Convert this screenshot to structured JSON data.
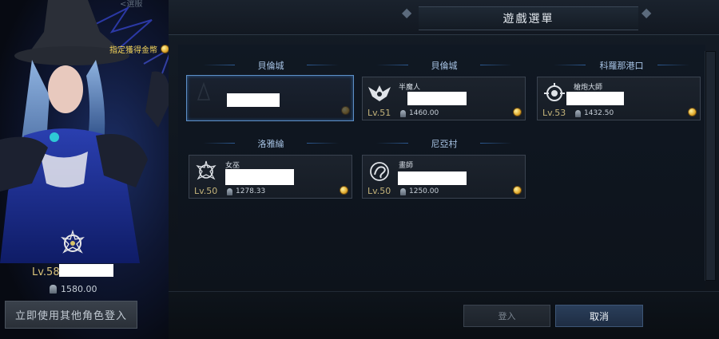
{
  "left_panel": {
    "top_label": "<選服",
    "gold_label": "指定獲得金幣",
    "main_character": {
      "level": "Lv.58",
      "item_level": "1580.00"
    },
    "other_character_button": "立即使用其他角色登入"
  },
  "menu": {
    "title": "遊戲選單",
    "servers": [
      {
        "name": "貝倫城",
        "characters": [
          {
            "class_name": "",
            "level": "",
            "item_level": "",
            "selected": true,
            "icon": "blank-class-icon"
          }
        ]
      },
      {
        "name": "貝倫城",
        "characters": [
          {
            "class_name": "半魔人",
            "level": "Lv.51",
            "item_level": "1460.00",
            "icon": "demon-class-icon"
          }
        ]
      },
      {
        "name": "科羅那港口",
        "characters": [
          {
            "class_name": "槍炮大師",
            "level": "Lv.53",
            "item_level": "1432.50",
            "icon": "gunner-class-icon"
          }
        ]
      },
      {
        "name": "洛雅綸",
        "characters": [
          {
            "class_name": "女巫",
            "level": "Lv.50",
            "item_level": "1278.33",
            "icon": "witch-class-icon"
          }
        ]
      },
      {
        "name": "尼亞村",
        "characters": [
          {
            "class_name": "畫師",
            "level": "Lv.50",
            "item_level": "1250.00",
            "icon": "artist-class-icon"
          }
        ]
      }
    ],
    "buttons": {
      "login": "登入",
      "cancel": "取消"
    }
  },
  "colors": {
    "accent_blue": "#5d8fc6",
    "gold": "#f2d35a",
    "level": "#c3b37a"
  }
}
